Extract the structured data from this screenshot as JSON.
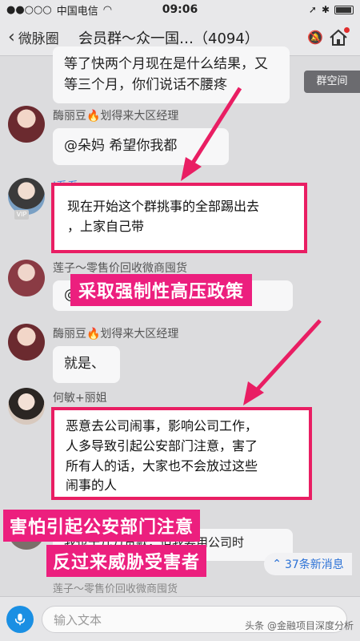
{
  "status_bar": {
    "carrier": "中国电信",
    "time": "09:06",
    "battery_text": ""
  },
  "nav": {
    "back_label": "微脉圈",
    "title": "会员群～众一国…（4094）"
  },
  "group_space_label": "群空间",
  "messages": [
    {
      "bubble": "等了快两个月现在是什么结果，又\n等三个月，你们说话不腰疼"
    },
    {
      "sender": "酶丽豆🔥划得来大区经理",
      "bubble": "@朵妈 希望你我都"
    },
    {
      "sender": "J系系",
      "bubble": "现在开始这个群挑事的全部踢出去\n，上家自己带"
    },
    {
      "sender": "莲子～零售价回收微商囤货",
      "bubble": "@"
    },
    {
      "sender": "酶丽豆🔥划得来大区经理",
      "bubble": "就是、"
    },
    {
      "sender": "何敏+丽姐",
      "bubble": "恶意去公司闹事，影响公司工作，\n人多导致引起公安部门注意，害了\n所有人的话，大家也不会放过这些\n闹事的人"
    },
    {
      "sender": "莲",
      "bubble": "我也十几万货款，但我要用公司时"
    }
  ],
  "overlays": {
    "label_1": "采取强制性高压政策",
    "label_2_line1": "害怕引起公安部门注意",
    "label_2_line2": "反过来威胁受害者"
  },
  "bottom": {
    "partial_sender": "莲子～零售价回收微商囤货",
    "new_messages": "37条新消息",
    "input_placeholder": "输入文本",
    "watermark": "头条 @金融项目深度分析"
  }
}
